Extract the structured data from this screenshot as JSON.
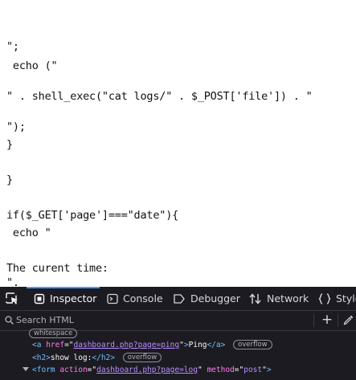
{
  "page": {
    "lines": [
      "\";",
      " echo (\"",
      "\" . shell_exec(\"cat logs/\" . $_POST['file']) . \"",
      "\");",
      "}",
      "}",
      "if($_GET['page']===\"date\"){",
      " echo \"",
      "The curent time:",
      "\"."
    ]
  },
  "devtools": {
    "tabs": [
      {
        "label": "Inspector",
        "icon": "inspector-icon"
      },
      {
        "label": "Console",
        "icon": "console-icon"
      },
      {
        "label": "Debugger",
        "icon": "debugger-icon"
      },
      {
        "label": "Network",
        "icon": "network-icon"
      },
      {
        "label": "Style",
        "icon": "style-editor-icon"
      }
    ],
    "search_placeholder": "Search HTML",
    "tree": {
      "whitespace_badge": "whitespace",
      "row1": {
        "tag_open": "<a",
        "attr": "href",
        "val": "dashboard.php?page=ping",
        "text": "Ping",
        "tag_close": "</a>",
        "badge": "overflow"
      },
      "row2": {
        "tag_open": "<h2>",
        "text": "show log:",
        "tag_close": "</h2>",
        "badge": "overflow"
      },
      "row3": {
        "tag_open": "<form",
        "attr1": "action",
        "val1": "dashboard.php?page=log",
        "attr2": "method",
        "val2": "post",
        "tag_end": ">"
      }
    }
  }
}
